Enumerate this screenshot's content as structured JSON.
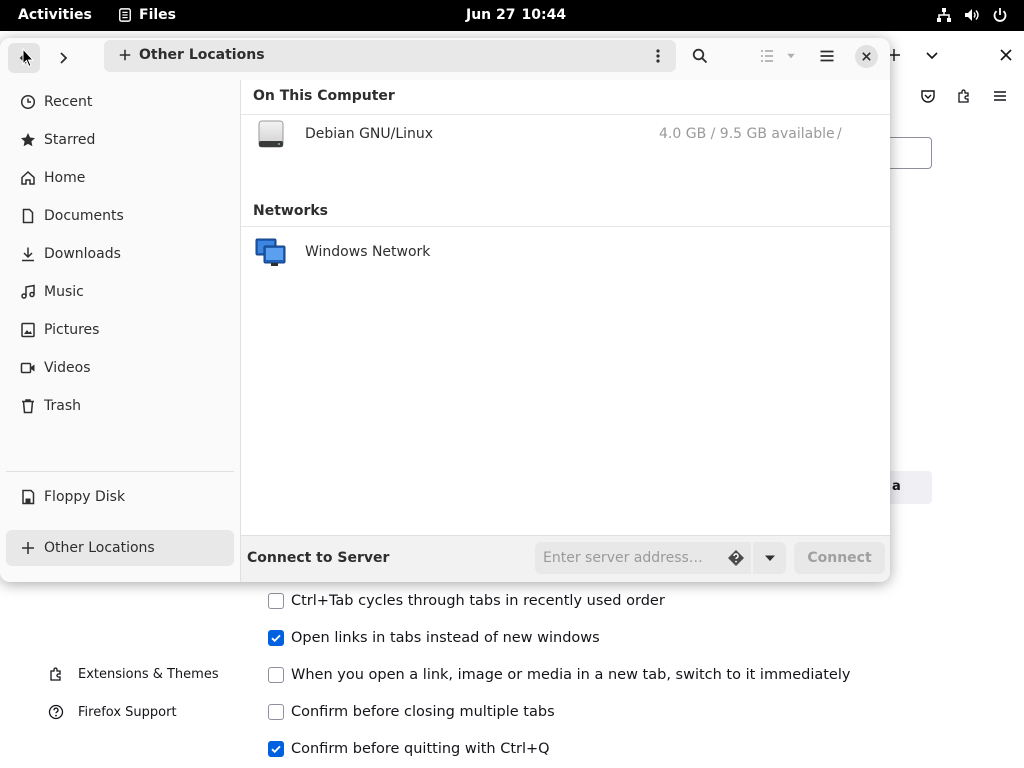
{
  "topbar": {
    "activities": "Activities",
    "app_name": "Files",
    "date": "Jun 27",
    "time": "10:44"
  },
  "files": {
    "path_label": "Other Locations",
    "sidebar": {
      "items": [
        {
          "label": "Recent",
          "icon": "clock-icon"
        },
        {
          "label": "Starred",
          "icon": "star-icon"
        },
        {
          "label": "Home",
          "icon": "home-icon"
        },
        {
          "label": "Documents",
          "icon": "document-icon"
        },
        {
          "label": "Downloads",
          "icon": "download-icon"
        },
        {
          "label": "Music",
          "icon": "music-icon"
        },
        {
          "label": "Pictures",
          "icon": "picture-icon"
        },
        {
          "label": "Videos",
          "icon": "video-icon"
        },
        {
          "label": "Trash",
          "icon": "trash-icon"
        },
        {
          "label": "Floppy Disk",
          "icon": "floppy-icon"
        },
        {
          "label": "Other Locations",
          "icon": "plus-icon",
          "active": true
        }
      ]
    },
    "sections": {
      "computer_heading": "On This Computer",
      "networks_heading": "Networks"
    },
    "computer_locations": [
      {
        "name": "Debian GNU/Linux",
        "info": "4.0 GB / 9.5 GB available",
        "path": "/"
      }
    ],
    "network_locations": [
      {
        "name": "Windows Network"
      }
    ],
    "connect_bar": {
      "label": "Connect to Server",
      "placeholder": "Enter server address…",
      "connect_button": "Connect"
    }
  },
  "firefox": {
    "partial_button": "a",
    "sidebar": {
      "extensions": "Extensions & Themes",
      "support": "Firefox Support"
    },
    "tab_settings": [
      {
        "label": "Ctrl+Tab cycles through tabs in recently used order",
        "checked": false
      },
      {
        "label": "Open links in tabs instead of new windows",
        "checked": true
      },
      {
        "label": "When you open a link, image or media in a new tab, switch to it immediately",
        "checked": false
      },
      {
        "label": "Confirm before closing multiple tabs",
        "checked": false
      },
      {
        "label": "Confirm before quitting with Ctrl+Q",
        "checked": true
      }
    ]
  },
  "colors": {
    "accent": "#0061e0",
    "topbar": "#000000",
    "sidebar_bg": "#fafafa"
  }
}
